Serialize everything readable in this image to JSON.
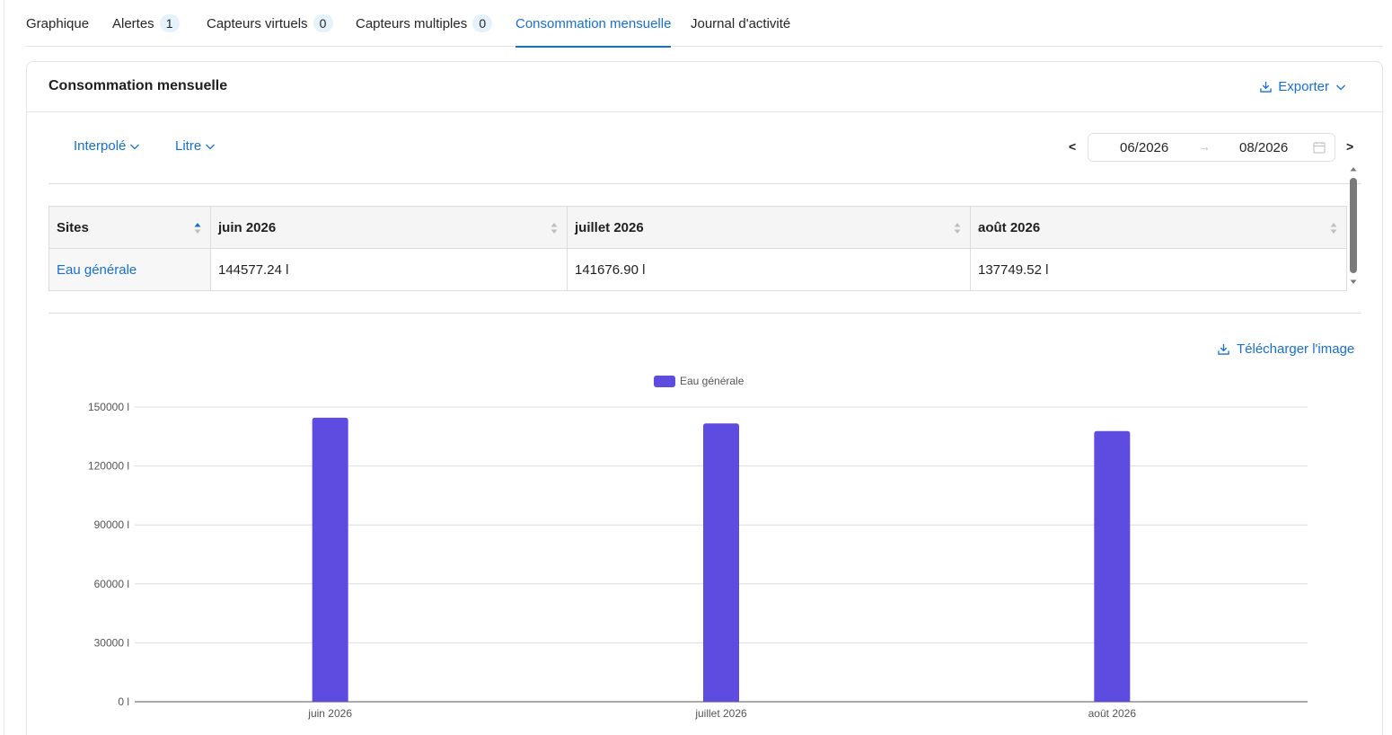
{
  "tabs": [
    {
      "label": "Graphique"
    },
    {
      "label": "Alertes",
      "badge": "1"
    },
    {
      "label": "Capteurs virtuels",
      "badge": "0"
    },
    {
      "label": "Capteurs multiples",
      "badge": "0"
    },
    {
      "label": "Consommation mensuelle",
      "active": true
    },
    {
      "label": "Journal d'activité"
    }
  ],
  "card": {
    "title": "Consommation mensuelle",
    "export_label": "Exporter"
  },
  "filters": {
    "mode": "Interpolé",
    "unit": "Litre"
  },
  "date_range": {
    "prev": "<",
    "start": "06/2026",
    "separator": "→",
    "end": "08/2026",
    "next": ">"
  },
  "table": {
    "headers": [
      "Sites",
      "juin 2026",
      "juillet 2026",
      "août 2026"
    ],
    "rows": [
      {
        "site": "Eau générale",
        "values": [
          "144577.24 l",
          "141676.90 l",
          "137749.52 l"
        ]
      }
    ]
  },
  "download_image_label": "Télécharger l'image",
  "colors": {
    "accent": "#1570d6",
    "bar": "#5e4be0"
  },
  "chart_data": {
    "type": "bar",
    "categories": [
      "juin 2026",
      "juillet 2026",
      "août 2026"
    ],
    "series": [
      {
        "name": "Eau générale",
        "values": [
          144577.24,
          141676.9,
          137749.52
        ]
      }
    ],
    "ylim": [
      0,
      150000
    ],
    "yticks": [
      0,
      30000,
      60000,
      90000,
      120000,
      150000
    ],
    "ytick_labels": [
      "0 l",
      "30000 l",
      "60000 l",
      "90000 l",
      "120000 l",
      "150000 l"
    ],
    "legend_position": "top-center",
    "grid": true
  }
}
